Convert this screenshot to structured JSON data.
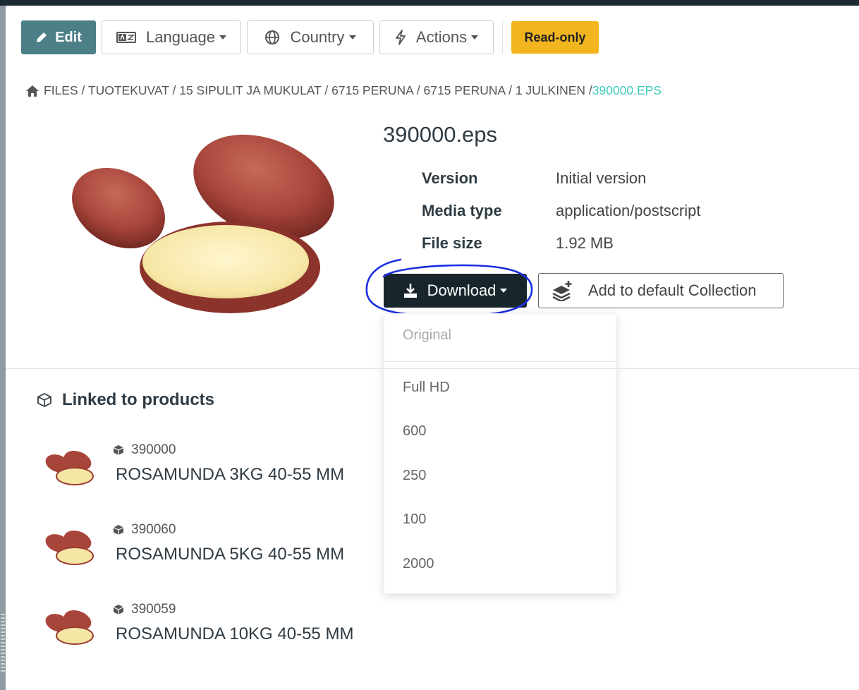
{
  "toolbar": {
    "edit_label": "Edit",
    "language_label": "Language",
    "country_label": "Country",
    "actions_label": "Actions",
    "readonly_badge": "Read-only"
  },
  "breadcrumb": {
    "path": "FILES / TUOTEKUVAT / 15 SIPULIT JA MUKULAT / 6715 PERUNA / 6715 PERUNA / 1 JULKINEN / ",
    "current": "390000.EPS"
  },
  "file": {
    "title": "390000.eps",
    "properties": [
      {
        "key": "Version",
        "value": "Initial version"
      },
      {
        "key": "Media type",
        "value": "application/postscript"
      },
      {
        "key": "File size",
        "value": "1.92 MB"
      }
    ],
    "download_label": "Download",
    "collection_label": "Add to default Collection"
  },
  "download_menu": {
    "header": "Original",
    "options": [
      "Full HD",
      "600",
      "250",
      "100",
      "2000"
    ]
  },
  "linked": {
    "title": "Linked to products",
    "products": [
      {
        "code": "390000",
        "name": "ROSAMUNDA 3KG 40-55 MM"
      },
      {
        "code": "390060",
        "name": "ROSAMUNDA 5KG 40-55 MM"
      },
      {
        "code": "390059",
        "name": "ROSAMUNDA 10KG 40-55 MM"
      }
    ]
  },
  "colors": {
    "edit_button": "#4d7f86",
    "readonly_badge": "#f2b51d",
    "download_button": "#18262c",
    "breadcrumb_current": "#3ec9b9",
    "annotation_ink": "#1a2ee0"
  },
  "icons": {
    "edit": "pencil-icon",
    "language": "language-icon",
    "country": "globe-icon",
    "actions": "bolt-icon",
    "home": "home-icon",
    "download": "download-icon",
    "collection": "layers-plus-icon",
    "linked": "cube-icon",
    "product": "cube-small-icon"
  }
}
